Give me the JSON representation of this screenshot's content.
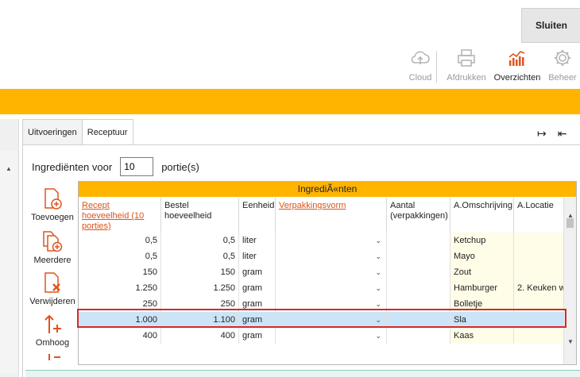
{
  "header": {
    "close_label": "Sluiten",
    "tools": [
      {
        "label": "Cloud",
        "icon": "cloud-upload-icon",
        "enabled": false
      },
      {
        "label": "Afdrukken",
        "icon": "printer-icon",
        "enabled": false
      },
      {
        "label": "Overzichten",
        "icon": "bar-chart-icon",
        "enabled": true
      },
      {
        "label": "Beheer",
        "icon": "gear-icon",
        "enabled": false
      }
    ]
  },
  "colors": {
    "accent": "#ffb400",
    "link": "#d9531e",
    "selection": "#cce4f7",
    "highlight_box": "#d42a2a",
    "label_column_bg": "#fffde8"
  },
  "tabs": [
    {
      "label": "Uitvoeringen",
      "active": false
    },
    {
      "label": "Receptuur",
      "active": true
    }
  ],
  "expand_icons": [
    "→|",
    "|←"
  ],
  "portions": {
    "label_before": "Ingrediënten voor",
    "value": "10",
    "label_after": "portie(s)"
  },
  "side_actions": [
    {
      "label": "Toevoegen",
      "icon": "add-document-icon"
    },
    {
      "label": "Meerdere",
      "icon": "add-multiple-documents-icon"
    },
    {
      "label": "Verwijderen",
      "icon": "delete-document-icon"
    },
    {
      "label": "Omhoog",
      "icon": "move-up-icon"
    }
  ],
  "grid": {
    "title": "IngrediÃ«nten",
    "columns": [
      {
        "label": "Recept hoeveelheid (10 porties)",
        "link": true
      },
      {
        "label": "Bestel hoeveelheid",
        "link": false
      },
      {
        "label": "Eenheid",
        "link": false
      },
      {
        "label": "Verpakkingsvorm",
        "link": true
      },
      {
        "label": "Aantal (verpakkingen)",
        "link": false
      },
      {
        "label": "A.Omschrijving",
        "link": false
      },
      {
        "label": "A.Locatie",
        "link": false
      }
    ],
    "rows": [
      {
        "recept": "0,5",
        "bestel": "0,5",
        "eenheid": "liter",
        "verpakking": "",
        "aantal": "",
        "omschrijving": "Ketchup",
        "locatie": "",
        "selected": false
      },
      {
        "recept": "0,5",
        "bestel": "0,5",
        "eenheid": "liter",
        "verpakking": "",
        "aantal": "",
        "omschrijving": "Mayo",
        "locatie": "",
        "selected": false
      },
      {
        "recept": "150",
        "bestel": "150",
        "eenheid": "gram",
        "verpakking": "",
        "aantal": "",
        "omschrijving": "Zout",
        "locatie": "",
        "selected": false
      },
      {
        "recept": "1.250",
        "bestel": "1.250",
        "eenheid": "gram",
        "verpakking": "",
        "aantal": "",
        "omschrijving": "Hamburger",
        "locatie": "2. Keuken w",
        "selected": false
      },
      {
        "recept": "250",
        "bestel": "250",
        "eenheid": "gram",
        "verpakking": "",
        "aantal": "",
        "omschrijving": "Bolletje",
        "locatie": "",
        "selected": false
      },
      {
        "recept": "1.000",
        "bestel": "1.100",
        "eenheid": "gram",
        "verpakking": "",
        "aantal": "",
        "omschrijving": "Sla",
        "locatie": "",
        "selected": true
      },
      {
        "recept": "400",
        "bestel": "400",
        "eenheid": "gram",
        "verpakking": "",
        "aantal": "",
        "omschrijving": "Kaas",
        "locatie": "",
        "selected": false
      }
    ]
  }
}
